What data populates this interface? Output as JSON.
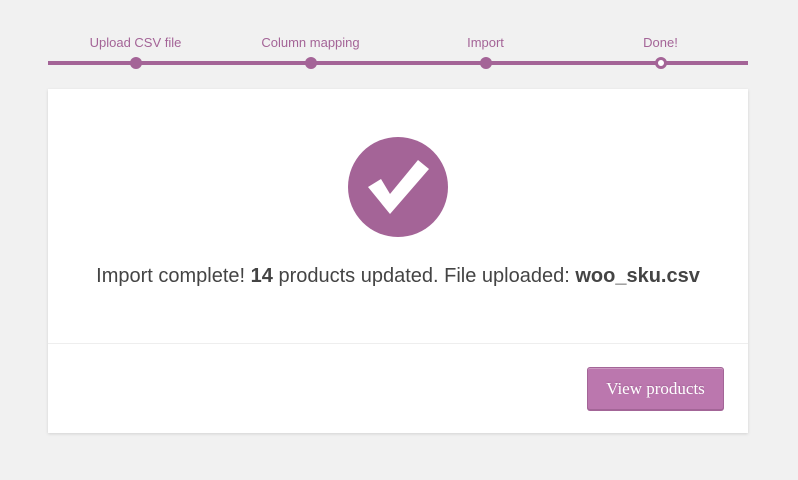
{
  "steps": [
    {
      "label": "Upload CSV file",
      "state": "done"
    },
    {
      "label": "Column mapping",
      "state": "done"
    },
    {
      "label": "Import",
      "state": "done"
    },
    {
      "label": "Done!",
      "state": "current"
    }
  ],
  "result": {
    "icon": "checkmark-icon",
    "prefix": "Import complete! ",
    "count": "14",
    "middle": " products updated. File uploaded: ",
    "filename": "woo_sku.csv"
  },
  "actions": {
    "view_products_label": "View products"
  },
  "colors": {
    "accent": "#a46497",
    "button": "#bb77ae",
    "background": "#f1f1f1",
    "text": "#444444"
  }
}
